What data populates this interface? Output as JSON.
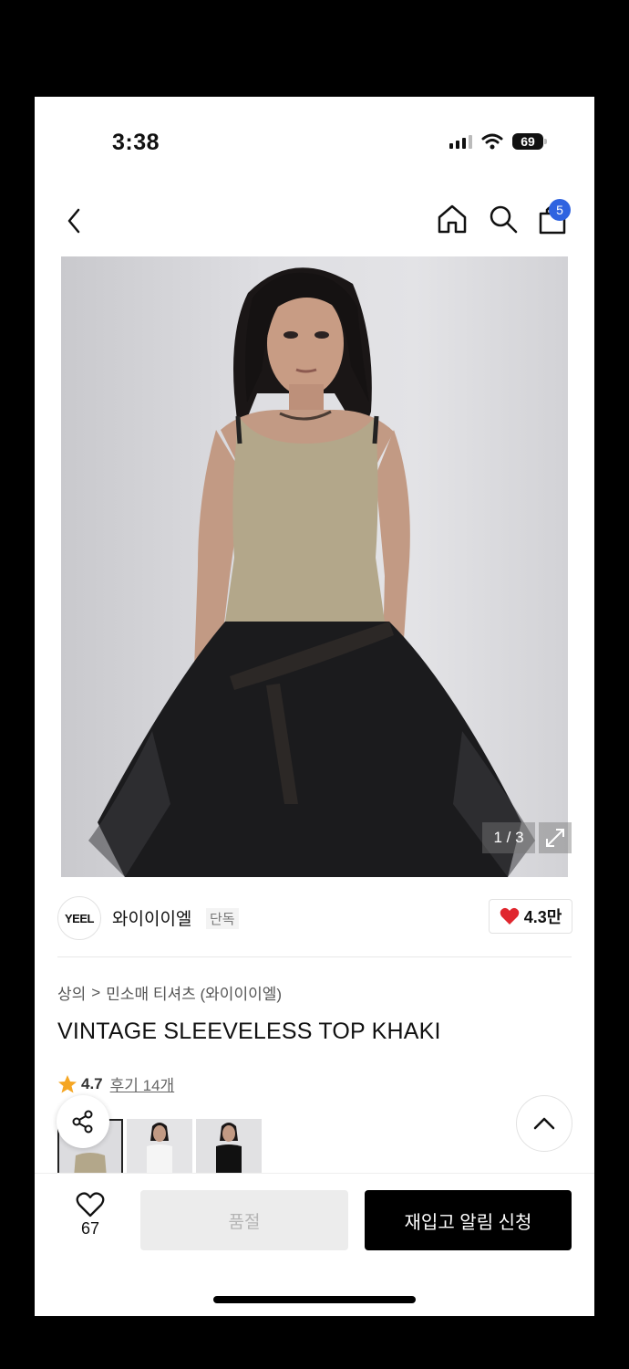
{
  "status_bar": {
    "time": "3:38",
    "battery": "69"
  },
  "nav": {
    "cart_count": "5"
  },
  "gallery": {
    "counter": "1 / 3"
  },
  "brand": {
    "logo_text": "YEEL",
    "name": "와이이이엘",
    "tag": "단독",
    "likes": "4.3만"
  },
  "breadcrumb": {
    "items": [
      "상의",
      "민소매 티셔츠 (와이이이엘)"
    ],
    "separator": ">"
  },
  "product": {
    "title": "VINTAGE SLEEVELESS TOP KHAKI",
    "rating": "4.7",
    "reviews": "후기 14개"
  },
  "bottom_bar": {
    "wish_count": "67",
    "soldout_label": "품절",
    "restock_label": "재입고 알림 신청"
  },
  "colors": {
    "accent_blue": "#2f63e0",
    "heart_red": "#e0262e",
    "star": "#f5a623",
    "garment_khaki": "#b3a78a"
  }
}
